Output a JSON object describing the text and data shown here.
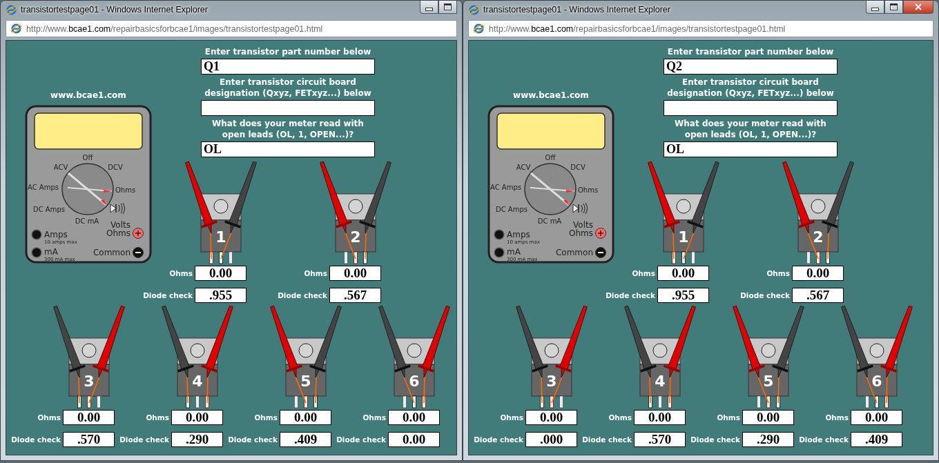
{
  "windows": [
    {
      "title": "transistortestpage01 - Windows Internet Explorer",
      "controls": [
        {
          "kind": "minimize"
        },
        {
          "kind": "maximize"
        }
      ],
      "address": "http://www.**bcae1.com**/repairbasicsforbcae1/images/transistortestpage01.html",
      "site_label": "www.bcae1.com",
      "meter": {
        "dial_labels": [
          "Off",
          "ACV",
          "DCV",
          "AC Amps",
          "Ohms",
          "DC Amps",
          "DC mA"
        ],
        "jacks": [
          {
            "kind": "socket",
            "lines": [
              "Amps"
            ],
            "note": "10 amps max"
          },
          {
            "kind": "socket",
            "lines": [
              "mA"
            ],
            "note": "300 mA max"
          },
          {
            "kind": "positive",
            "lines": [
              "Volts",
              "Ohms"
            ]
          },
          {
            "kind": "negative",
            "lines": [
              "Common"
            ]
          }
        ]
      },
      "form": [
        {
          "label": "Enter transistor part number below",
          "value": "Q1"
        },
        {
          "label": "Enter transistor circuit board\ndesignation (Qxyz, FETxyz...) below"
        },
        {
          "label": "What does your meter read with\nopen leads (OL, 1, OPEN...)?",
          "value": "OL"
        }
      ],
      "tests": [
        {
          "number": "1",
          "ohms_label": "Ohms",
          "ohms": "0.00",
          "diode_label": "Diode check",
          "diode": ".955",
          "pins": [
            {
              "red": true,
              "black": false
            },
            {
              "red": false,
              "black": true
            },
            {
              "red": false,
              "black": false
            }
          ]
        },
        {
          "number": "2",
          "ohms_label": "Ohms",
          "ohms": "0.00",
          "diode_label": "Diode check",
          "diode": ".567",
          "pins": [
            {
              "red": false,
              "black": false
            },
            {
              "red": true,
              "black": false
            },
            {
              "red": false,
              "black": true
            }
          ]
        },
        {
          "number": "3",
          "ohms_label": "Ohms",
          "ohms": "0.00",
          "diode_label": "Diode check",
          "diode": ".570",
          "pins": [
            {
              "red": false,
              "black": true
            },
            {
              "red": true,
              "black": false
            },
            {
              "red": false,
              "black": false
            }
          ]
        },
        {
          "number": "4",
          "ohms_label": "Ohms",
          "ohms": "0.00",
          "diode_label": "Diode check",
          "diode": ".290",
          "pins": [
            {
              "red": false,
              "black": true
            },
            {
              "red": false,
              "black": false
            },
            {
              "red": true,
              "black": false
            }
          ]
        },
        {
          "number": "5",
          "ohms_label": "Ohms",
          "ohms": "0.00",
          "diode_label": "Diode check",
          "diode": ".409",
          "pins": [
            {
              "red": false,
              "black": false
            },
            {
              "red": true,
              "black": false
            },
            {
              "red": false,
              "black": true
            }
          ]
        },
        {
          "number": "6",
          "ohms_label": "Ohms",
          "ohms": "0.00",
          "diode_label": "Diode check",
          "diode": "0.00",
          "pins": [
            {
              "red": false,
              "black": false
            },
            {
              "red": false,
              "black": true
            },
            {
              "red": true,
              "black": false
            }
          ]
        }
      ]
    },
    {
      "title": "transistortestpage01 - Windows Internet Explorer",
      "controls": [
        {
          "kind": "minimize"
        },
        {
          "kind": "maximize"
        },
        {
          "kind": "close"
        }
      ],
      "address": "http://www.**bcae1.com**/repairbasicsforbcae1/images/transistortestpage01.html",
      "site_label": "www.bcae1.com",
      "meter": {
        "dial_labels": [
          "Off",
          "ACV",
          "DCV",
          "AC Amps",
          "Ohms",
          "DC Amps",
          "DC mA"
        ],
        "jacks": [
          {
            "kind": "socket",
            "lines": [
              "Amps"
            ],
            "note": "10 amps max"
          },
          {
            "kind": "socket",
            "lines": [
              "mA"
            ],
            "note": "300 mA max"
          },
          {
            "kind": "positive",
            "lines": [
              "Volts",
              "Ohms"
            ]
          },
          {
            "kind": "negative",
            "lines": [
              "Common"
            ]
          }
        ]
      },
      "form": [
        {
          "label": "Enter transistor part number below",
          "value": "Q2"
        },
        {
          "label": "Enter transistor circuit board\ndesignation (Qxyz, FETxyz...) below"
        },
        {
          "label": "What does your meter read with\nopen leads (OL, 1, OPEN...)?",
          "value": "OL"
        }
      ],
      "tests": [
        {
          "number": "1",
          "ohms_label": "Ohms",
          "ohms": "0.00",
          "diode_label": "Diode check",
          "diode": ".955",
          "pins": [
            {
              "red": true,
              "black": false
            },
            {
              "red": false,
              "black": true
            },
            {
              "red": false,
              "black": false
            }
          ]
        },
        {
          "number": "2",
          "ohms_label": "Ohms",
          "ohms": "0.00",
          "diode_label": "Diode check",
          "diode": ".567",
          "pins": [
            {
              "red": false,
              "black": false
            },
            {
              "red": true,
              "black": false
            },
            {
              "red": false,
              "black": true
            }
          ]
        },
        {
          "number": "3",
          "ohms_label": "Ohms",
          "ohms": "0.00",
          "diode_label": "Diode check",
          "diode": ".000",
          "pins": [
            {
              "red": false,
              "black": true
            },
            {
              "red": true,
              "black": false
            },
            {
              "red": false,
              "black": false
            }
          ]
        },
        {
          "number": "4",
          "ohms_label": "Ohms",
          "ohms": "0.00",
          "diode_label": "Diode check",
          "diode": ".570",
          "pins": [
            {
              "red": false,
              "black": true
            },
            {
              "red": false,
              "black": false
            },
            {
              "red": true,
              "black": false
            }
          ]
        },
        {
          "number": "5",
          "ohms_label": "Ohms",
          "ohms": "0.00",
          "diode_label": "Diode check",
          "diode": ".290",
          "pins": [
            {
              "red": false,
              "black": false
            },
            {
              "red": true,
              "black": false
            },
            {
              "red": false,
              "black": true
            }
          ]
        },
        {
          "number": "6",
          "ohms_label": "Ohms",
          "ohms": "0.00",
          "diode_label": "Diode check",
          "diode": ".409",
          "pins": [
            {
              "red": false,
              "black": false
            },
            {
              "red": false,
              "black": true
            },
            {
              "red": true,
              "black": false
            }
          ]
        }
      ]
    }
  ]
}
